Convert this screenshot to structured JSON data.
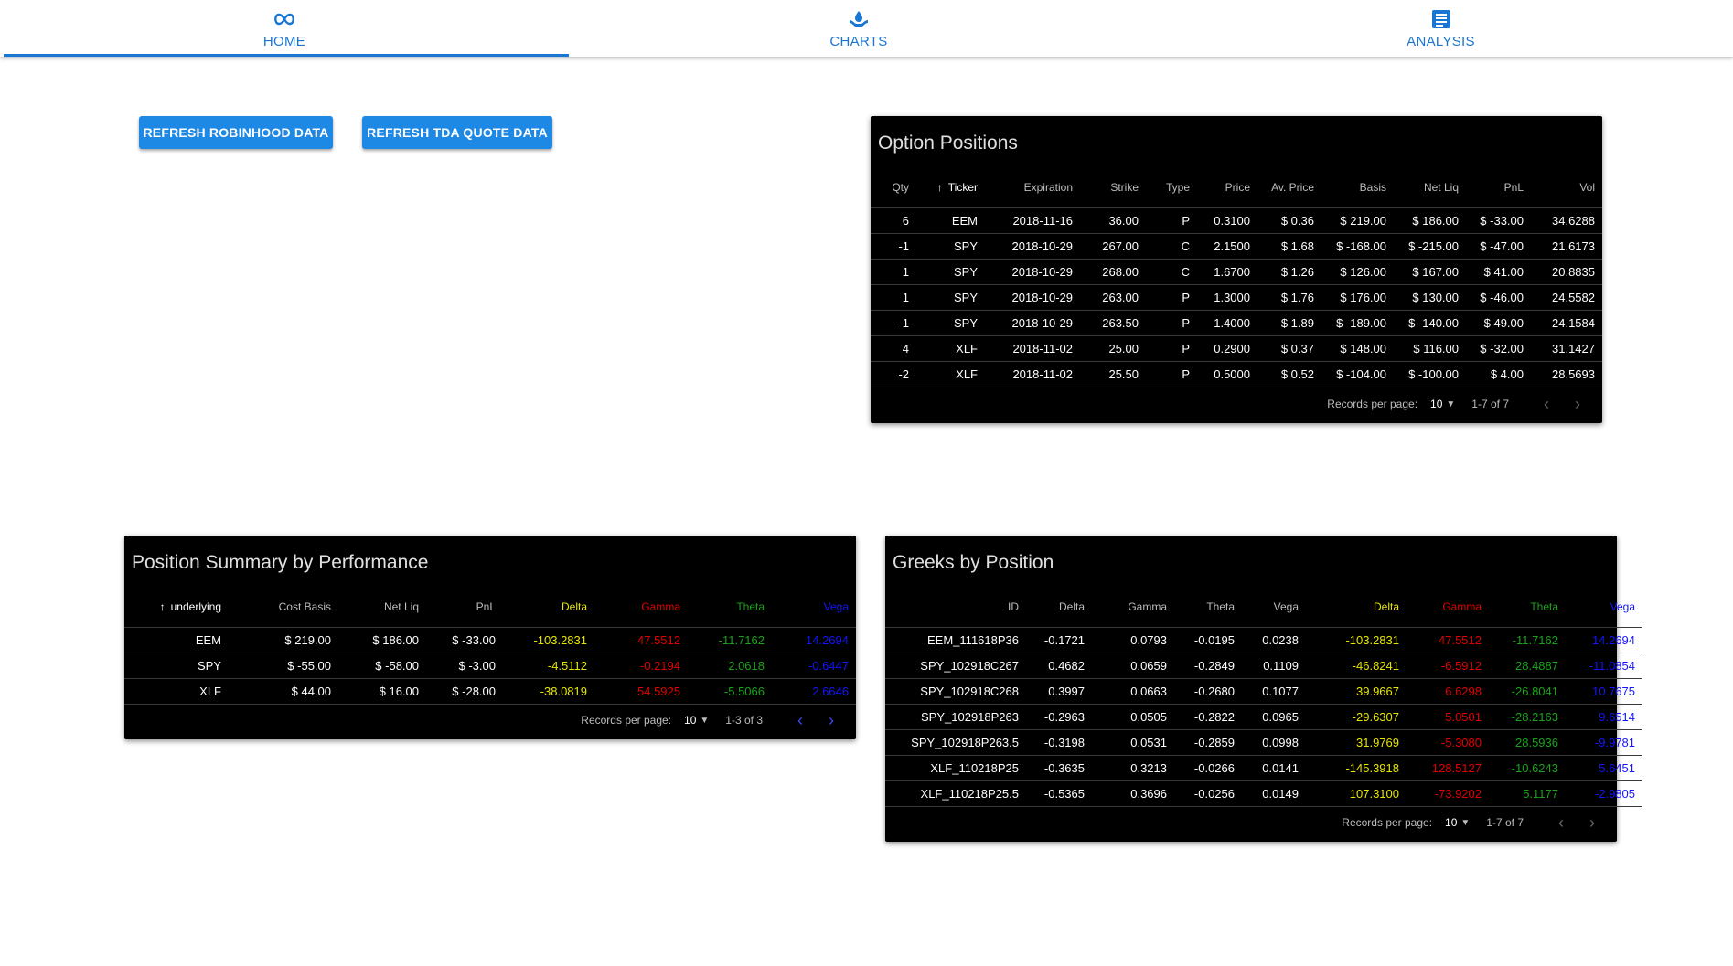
{
  "tabs": [
    {
      "label": "HOME",
      "icon": "infinity-icon",
      "active": true
    },
    {
      "label": "CHARTS",
      "icon": "droplet-hand-icon",
      "active": false
    },
    {
      "label": "ANALYSIS",
      "icon": "document-icon",
      "active": false
    }
  ],
  "buttons": {
    "refresh_robinhood": "REFRESH ROBINHOOD DATA",
    "refresh_tda": "REFRESH TDA QUOTE DATA"
  },
  "colors": {
    "accent": "#1976d2",
    "button": "#1e88e5",
    "card_bg": "#000000",
    "delta": "#e6e600",
    "gamma": "#e00000",
    "theta": "#1aa31a",
    "vega": "#1414ff"
  },
  "option_positions": {
    "title": "Option Positions",
    "columns": [
      "Qty",
      "Ticker",
      "Expiration",
      "Strike",
      "Type",
      "Price",
      "Av. Price",
      "Basis",
      "Net Liq",
      "PnL",
      "Vol"
    ],
    "sorted_column": "Ticker",
    "rows": [
      [
        "6",
        "EEM",
        "2018-11-16",
        "36.00",
        "P",
        "0.3100",
        "$ 0.36",
        "$ 219.00",
        "$ 186.00",
        "$ -33.00",
        "34.6288"
      ],
      [
        "-1",
        "SPY",
        "2018-10-29",
        "267.00",
        "C",
        "2.1500",
        "$ 1.68",
        "$ -168.00",
        "$ -215.00",
        "$ -47.00",
        "21.6173"
      ],
      [
        "1",
        "SPY",
        "2018-10-29",
        "268.00",
        "C",
        "1.6700",
        "$ 1.26",
        "$ 126.00",
        "$ 167.00",
        "$ 41.00",
        "20.8835"
      ],
      [
        "1",
        "SPY",
        "2018-10-29",
        "263.00",
        "P",
        "1.3000",
        "$ 1.76",
        "$ 176.00",
        "$ 130.00",
        "$ -46.00",
        "24.5582"
      ],
      [
        "-1",
        "SPY",
        "2018-10-29",
        "263.50",
        "P",
        "1.4000",
        "$ 1.89",
        "$ -189.00",
        "$ -140.00",
        "$ 49.00",
        "24.1584"
      ],
      [
        "4",
        "XLF",
        "2018-11-02",
        "25.00",
        "P",
        "0.2900",
        "$ 0.37",
        "$ 148.00",
        "$ 116.00",
        "$ -32.00",
        "31.1427"
      ],
      [
        "-2",
        "XLF",
        "2018-11-02",
        "25.50",
        "P",
        "0.5000",
        "$ 0.52",
        "$ -104.00",
        "$ -100.00",
        "$ 4.00",
        "28.5693"
      ]
    ],
    "footer": {
      "records_label": "Records per page:",
      "per_page": "10",
      "range": "1-7 of 7"
    }
  },
  "position_summary": {
    "title": "Position Summary by Performance",
    "columns": [
      "underlying",
      "Cost Basis",
      "Net Liq",
      "PnL",
      "Delta",
      "Gamma",
      "Theta",
      "Vega"
    ],
    "sorted_column": "underlying",
    "rows": [
      [
        "EEM",
        "$ 219.00",
        "$ 186.00",
        "$ -33.00",
        "-103.2831",
        "47.5512",
        "-11.7162",
        "14.2694"
      ],
      [
        "SPY",
        "$ -55.00",
        "$ -58.00",
        "$ -3.00",
        "-4.5112",
        "-0.2194",
        "2.0618",
        "-0.6447"
      ],
      [
        "XLF",
        "$ 44.00",
        "$ 16.00",
        "$ -28.00",
        "-38.0819",
        "54.5925",
        "-5.5066",
        "2.6646"
      ]
    ],
    "footer": {
      "records_label": "Records per page:",
      "per_page": "10",
      "range": "1-3 of 3"
    }
  },
  "greeks_by_position": {
    "title": "Greeks by Position",
    "columns": [
      "ID",
      "Delta",
      "Gamma",
      "Theta",
      "Vega",
      "Delta",
      "Gamma",
      "Theta",
      "Vega"
    ],
    "rows": [
      [
        "EEM_111618P36",
        "-0.1721",
        "0.0793",
        "-0.0195",
        "0.0238",
        "-103.2831",
        "47.5512",
        "-11.7162",
        "14.2694"
      ],
      [
        "SPY_102918C267",
        "0.4682",
        "0.0659",
        "-0.2849",
        "0.1109",
        "-46.8241",
        "-6.5912",
        "28.4887",
        "-11.0854"
      ],
      [
        "SPY_102918C268",
        "0.3997",
        "0.0663",
        "-0.2680",
        "0.1077",
        "39.9667",
        "6.6298",
        "-26.8041",
        "10.7675"
      ],
      [
        "SPY_102918P263",
        "-0.2963",
        "0.0505",
        "-0.2822",
        "0.0965",
        "-29.6307",
        "5.0501",
        "-28.2163",
        "9.6514"
      ],
      [
        "SPY_102918P263.5",
        "-0.3198",
        "0.0531",
        "-0.2859",
        "0.0998",
        "31.9769",
        "-5.3080",
        "28.5936",
        "-9.9781"
      ],
      [
        "XLF_110218P25",
        "-0.3635",
        "0.3213",
        "-0.0266",
        "0.0141",
        "-145.3918",
        "128.5127",
        "-10.6243",
        "5.6451"
      ],
      [
        "XLF_110218P25.5",
        "-0.5365",
        "0.3696",
        "-0.0256",
        "0.0149",
        "107.3100",
        "-73.9202",
        "5.1177",
        "-2.9805"
      ]
    ],
    "footer": {
      "records_label": "Records per page:",
      "per_page": "10",
      "range": "1-7 of 7"
    }
  }
}
